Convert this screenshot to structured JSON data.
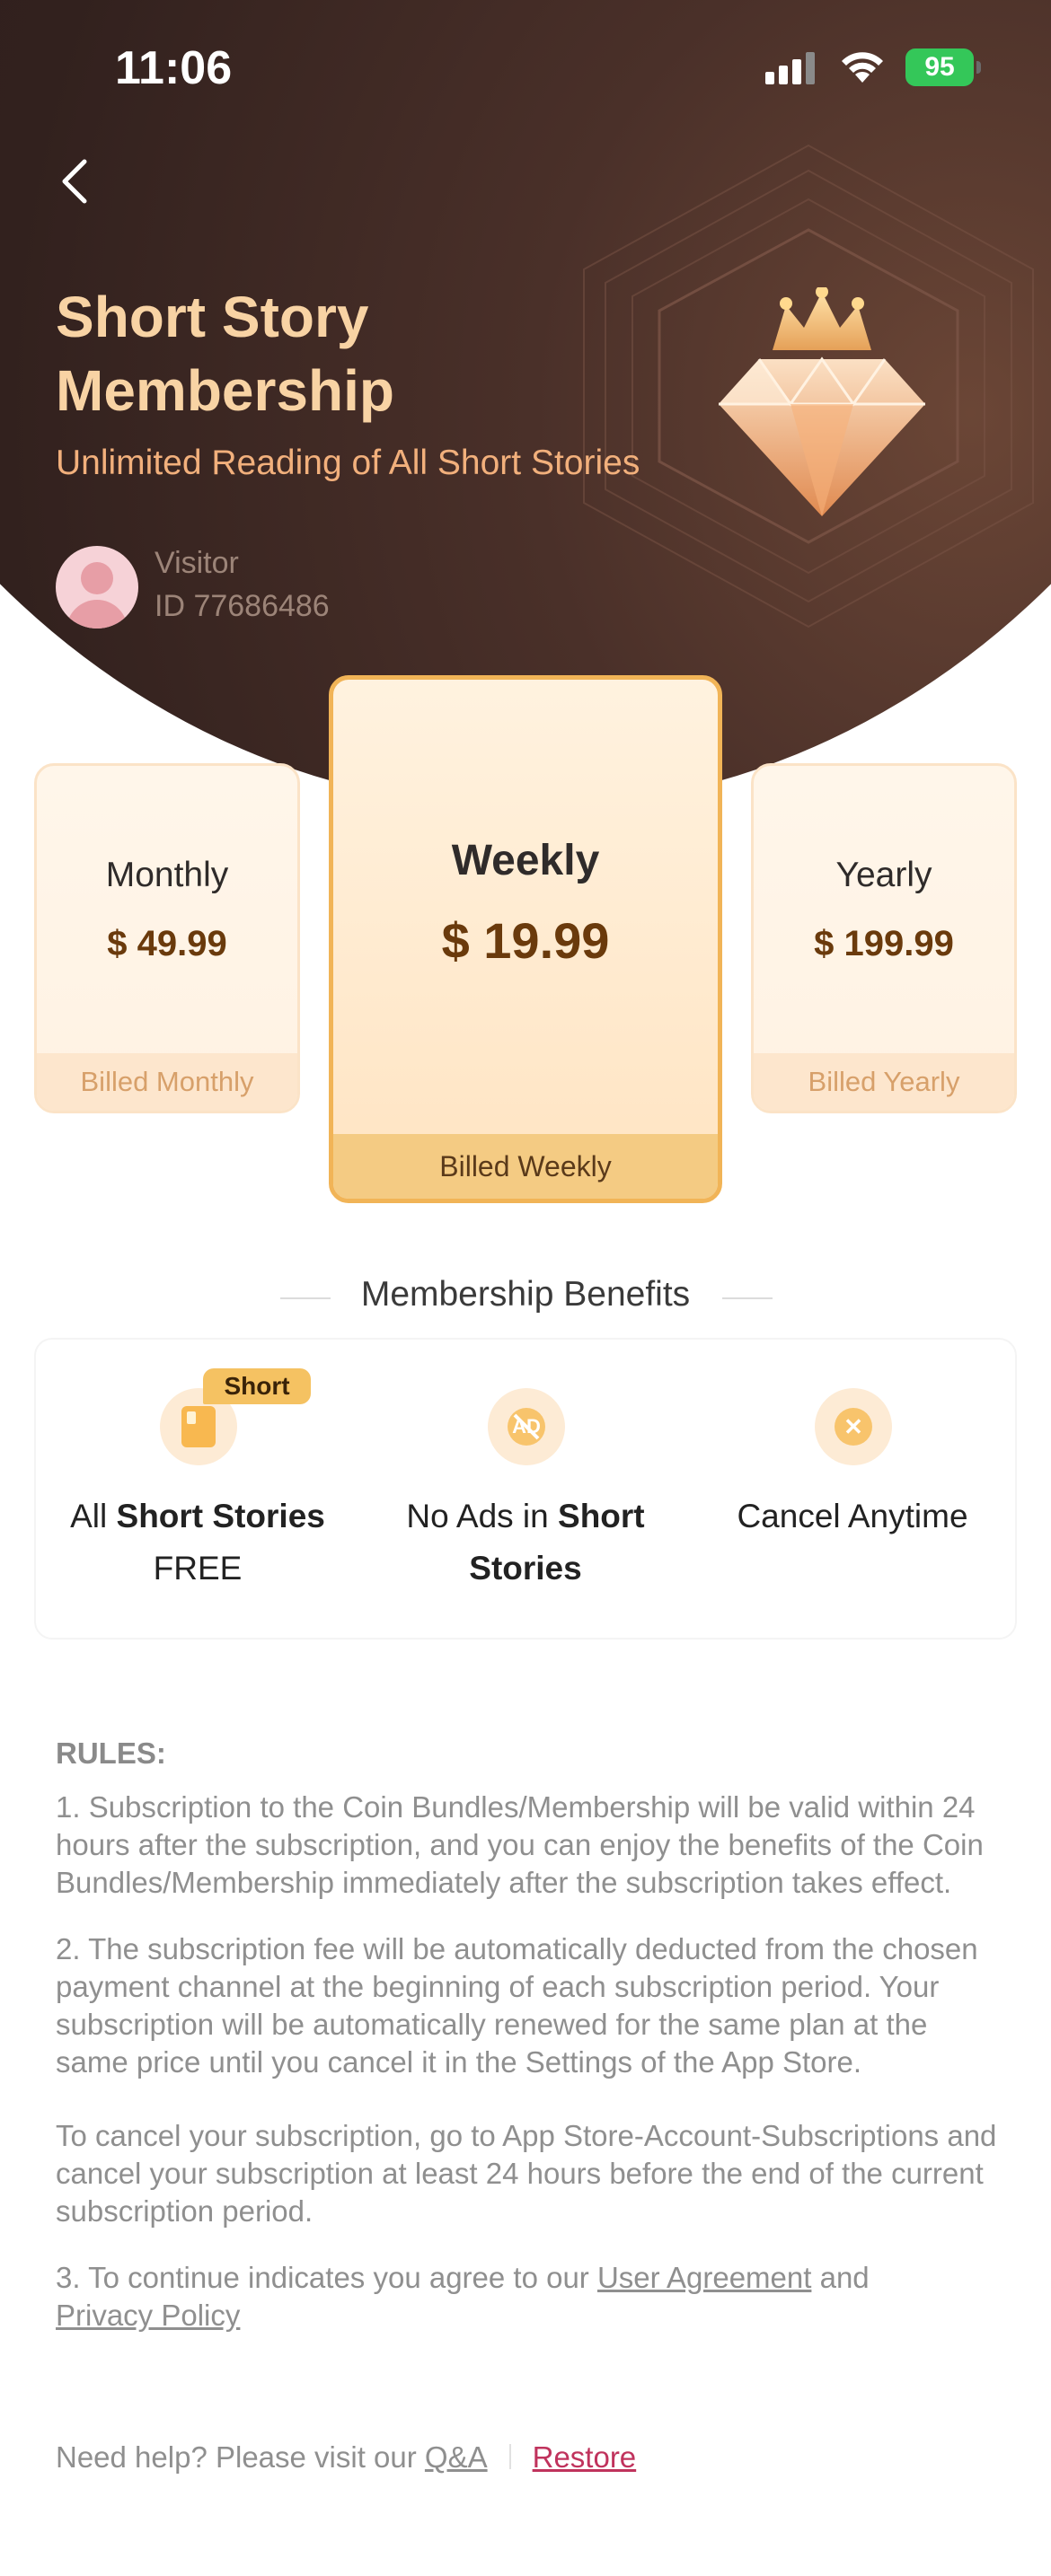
{
  "status_bar": {
    "time": "11:06",
    "battery": "95"
  },
  "header": {
    "title": "Short Story Membership",
    "subtitle": "Unlimited Reading of All Short Stories",
    "user": {
      "name": "Visitor",
      "id": "ID 77686486"
    }
  },
  "plans": [
    {
      "name": "Monthly",
      "price": "$ 49.99",
      "billing": "Billed Monthly",
      "selected": false
    },
    {
      "name": "Weekly",
      "price": "$ 19.99",
      "billing": "Billed Weekly",
      "selected": true
    },
    {
      "name": "Yearly",
      "price": "$ 199.99",
      "billing": "Billed Yearly",
      "selected": false
    }
  ],
  "benefits": {
    "title": "Membership Benefits",
    "tag": "Short",
    "items": [
      {
        "pre": "All ",
        "bold": "Short Stories",
        "post": "FREE",
        "icon": "book-icon"
      },
      {
        "pre": "No Ads in ",
        "bold": "Short Stories",
        "post": "",
        "icon": "no-ads-icon"
      },
      {
        "pre": "Cancel Anytime",
        "bold": "",
        "post": "",
        "icon": "cancel-icon"
      }
    ]
  },
  "rules": {
    "heading": "RULES:",
    "p1": "1. Subscription to the Coin Bundles/Membership will be valid within 24 hours after the subscription, and you can enjoy the benefits of the Coin Bundles/Membership immediately after the subscription takes effect.",
    "p2": "2. The subscription fee will be automatically deducted from the chosen payment channel at the beginning of each subscription period. Your subscription will be automatically renewed for the same plan at the same price until you cancel it in the Settings of the App Store.",
    "p3": "To cancel your subscription, go to App Store-Account-Subscriptions and cancel your subscription at least 24 hours before the end of the current subscription period.",
    "p4_prefix": "3. To continue indicates you agree to our ",
    "user_agreement": "User Agreement",
    "p4_and": " and",
    "privacy_policy": "Privacy Policy"
  },
  "help": {
    "prefix": "Need help? Please visit our ",
    "qa": "Q&A",
    "restore": "Restore"
  },
  "colors": {
    "accent": "#f1b457",
    "restore": "#c0335d",
    "title": "#f8d3a4"
  }
}
